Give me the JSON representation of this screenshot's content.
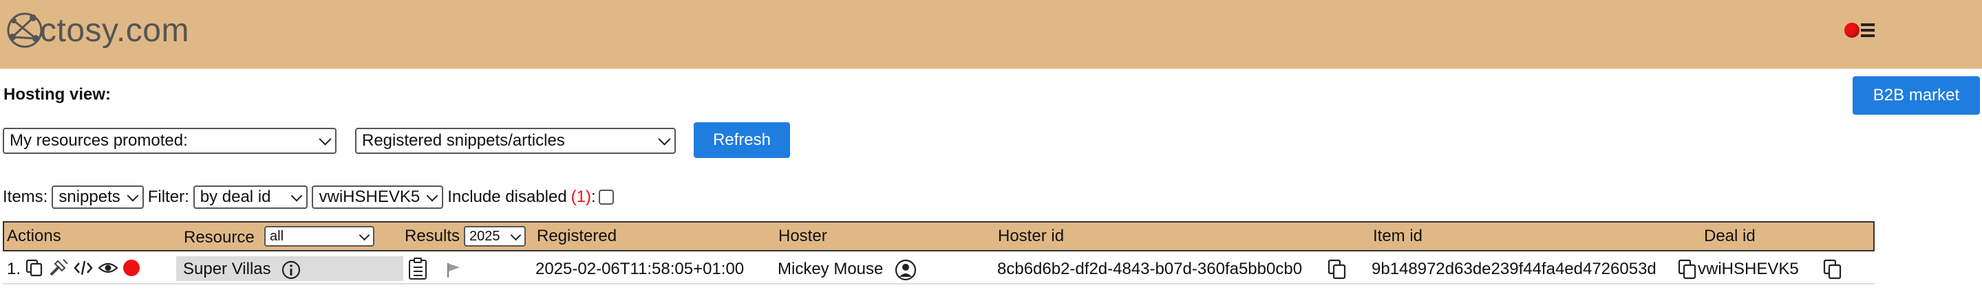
{
  "header": {
    "site_name": "ctosy.com",
    "logo_icon": "network-logo-icon",
    "menu_icon": "hamburger-menu-icon",
    "status_dot_color": "#e11111",
    "background": "#e0b886"
  },
  "hosting": {
    "label": "Hosting view:",
    "resources_select": "My resources promoted:",
    "type_select": "Registered snippets/articles",
    "refresh_label": "Refresh",
    "b2b_label": "B2B market"
  },
  "filters": {
    "items_label": "Items:",
    "items_value": "snippets",
    "filter_label": "Filter:",
    "filter_value": "by deal id",
    "deal_value": "vwiHSHEVK5",
    "include_disabled_label": "Include disabled",
    "disabled_count": "(1)",
    "colon": ":",
    "include_disabled_checked": false
  },
  "table": {
    "headers": {
      "actions": "Actions",
      "resource": "Resource",
      "resource_filter": "all",
      "results": "Results",
      "results_year": "2025",
      "registered": "Registered",
      "hoster": "Hoster",
      "hoster_id": "Hoster id",
      "item_id": "Item id",
      "deal_id": "Deal id"
    },
    "rows": [
      {
        "index": "1.",
        "resource": "Super Villas",
        "registered": "2025-02-06T11:58:05+01:00",
        "hoster": "Mickey Mouse",
        "hoster_id": "8cb6d6b2-df2d-4843-b07d-360fa5bb0cb0",
        "item_id": "9b148972d63de239f44fa4ed4726053d",
        "deal_id": "vwiHSHEVK5"
      }
    ]
  },
  "colors": {
    "accent": "#1f7de0",
    "header_bg": "#e0b886",
    "warning": "#e11111"
  }
}
